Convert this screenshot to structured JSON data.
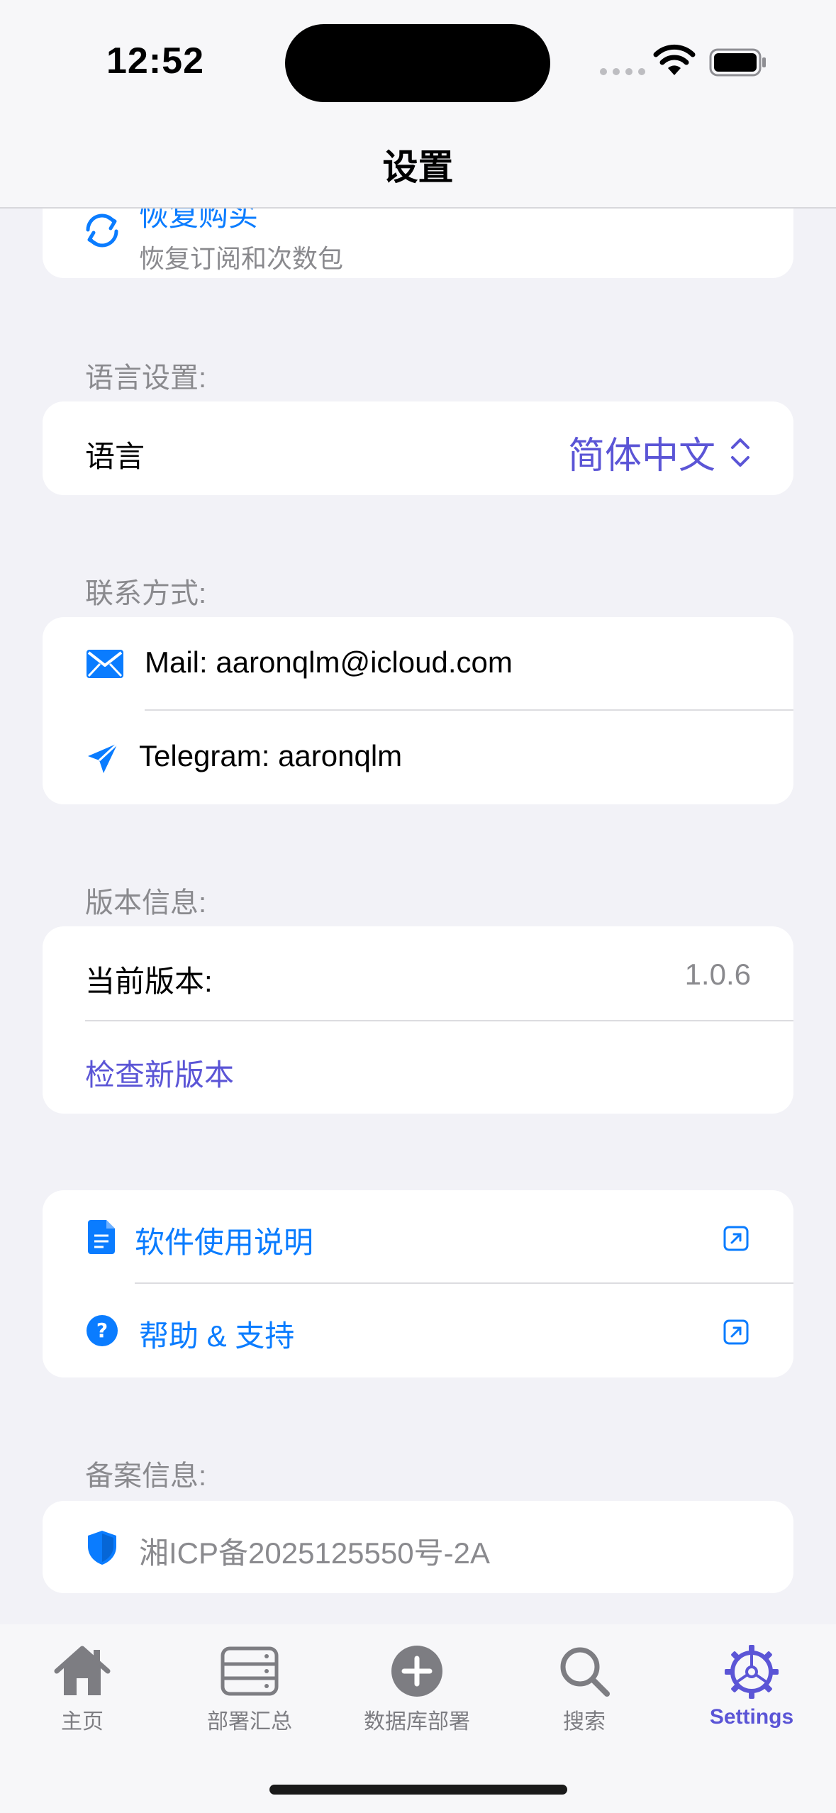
{
  "status_bar": {
    "time": "12:52"
  },
  "nav": {
    "title": "设置"
  },
  "restore": {
    "title": "恢复购买",
    "subtitle": "恢复订阅和次数包"
  },
  "language_section": {
    "header": "语言设置:",
    "label": "语言",
    "value": "简体中文"
  },
  "contact_section": {
    "header": "联系方式:",
    "mail": "Mail: aaronqlm@icloud.com",
    "telegram": "Telegram: aaronqlm"
  },
  "version_section": {
    "header": "版本信息:",
    "current_label": "当前版本:",
    "current_value": "1.0.6",
    "check_label": "检查新版本"
  },
  "links_section": {
    "manual": "软件使用说明",
    "help": "帮助 & 支持"
  },
  "filing_section": {
    "header": "备案信息:",
    "icp": "湘ICP备2025125550号-2A"
  },
  "tabs": [
    {
      "label": "主页",
      "icon": "house-icon"
    },
    {
      "label": "部署汇总",
      "icon": "server-icon"
    },
    {
      "label": "数据库部署",
      "icon": "plus-circle-icon"
    },
    {
      "label": "搜索",
      "icon": "magnifying-glass-icon"
    },
    {
      "label": "Settings",
      "icon": "gear-icon",
      "active": true
    }
  ],
  "colors": {
    "accent_blue": "#0a7cff",
    "accent_purple": "#5b55d6",
    "background": "#f2f2f7",
    "secondary_text": "#8a8a8e"
  }
}
